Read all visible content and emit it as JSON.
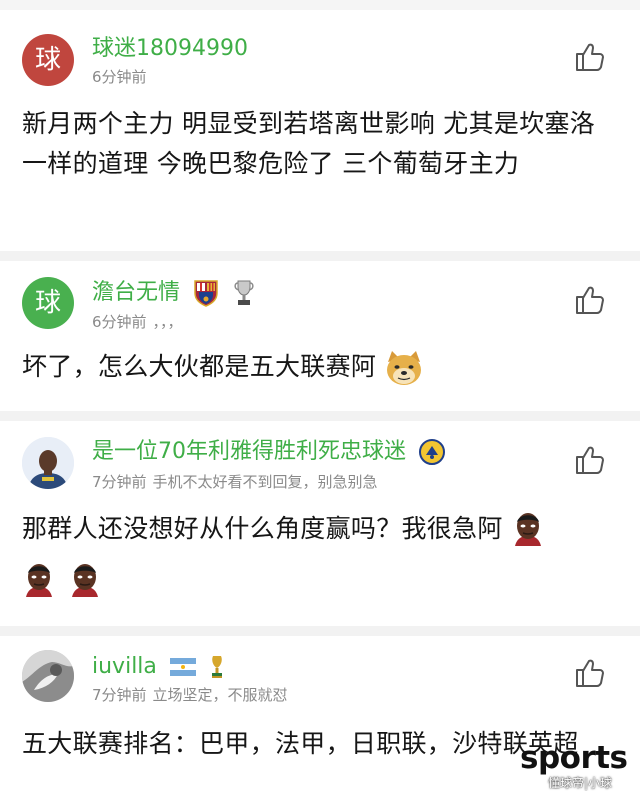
{
  "comments": [
    {
      "avatar_char": "球",
      "avatar_color": "#c0463e",
      "username": "球迷18094990",
      "time": "6分钟前",
      "extra": "",
      "text": "新月两个主力 明显受到若塔离世影响 尤其是坎塞洛 一样的道理 今晚巴黎危险了 三个葡萄牙主力",
      "badges": []
    },
    {
      "avatar_char": "球",
      "avatar_color": "#49b04f",
      "username": "澹台无情",
      "time": "6分钟前",
      "extra": "，，，",
      "text": "坏了，怎么大伙都是五大联赛阿",
      "badges": [
        "barcelona-badge-icon",
        "trophy-icon"
      ]
    },
    {
      "avatar_char": "",
      "avatar_color": "#2c4a7a",
      "username": "是一位70年利雅得胜利死忠球迷",
      "time": "7分钟前",
      "extra": "手机不太好看不到回复，别急别急",
      "text": "那群人还没想好从什么角度赢吗？我很急阿",
      "badges": [
        "al-nassr-badge-icon"
      ]
    },
    {
      "avatar_char": "",
      "avatar_color": "#9a9a9a",
      "username": "iuvilla",
      "time": "7分钟前",
      "extra": "立场坚定，不服就怼",
      "text": "五大联赛排名：巴甲，法甲，日职联，沙特联英超",
      "badges": [
        "argentina-flag-icon",
        "world-cup-trophy-icon"
      ]
    }
  ],
  "watermark": {
    "title": "sports",
    "subtitle": "懂球帝|小球"
  }
}
